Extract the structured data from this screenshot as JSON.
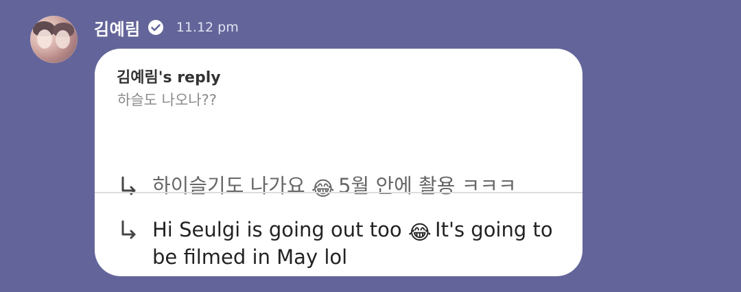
{
  "message": {
    "author": "김예림",
    "verified_icon": "verified-badge-icon",
    "time": "11.12 pm",
    "reply": {
      "title": "김예림's reply",
      "quoted_text": "하슬도 나오나??"
    },
    "korean_line": {
      "arrow_icon": "reply-arrow-icon",
      "before_emoji": "하이슬기도 나가요 ",
      "emoji": "😂",
      "after_emoji": " 5월 안에 촬용 ㅋㅋㅋ"
    },
    "english_line": {
      "arrow_icon": "reply-arrow-icon",
      "before_emoji": "Hi Seulgi is going out too ",
      "emoji": "😂",
      "after_emoji": " It's going to be filmed in May lol"
    }
  },
  "colors": {
    "background": "#63659a",
    "bubble": "#ffffff",
    "name": "#ffffff",
    "timestamp": "#e3e4f1",
    "divider": "#dcdcdc"
  }
}
